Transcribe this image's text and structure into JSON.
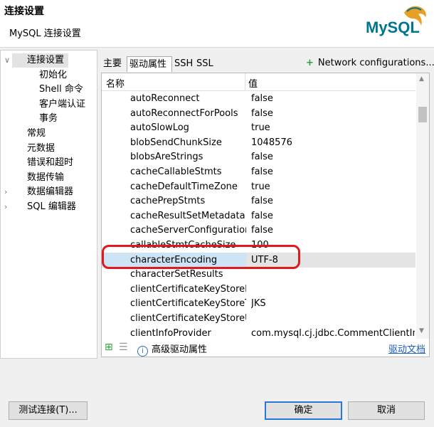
{
  "header": {
    "title": "连接设置",
    "subtitle": "MySQL 连接设置",
    "logo_text": "MySQL"
  },
  "nav": {
    "items": [
      {
        "label": "连接设置",
        "level": 0,
        "expanded": true,
        "selected": true
      },
      {
        "label": "初始化",
        "level": 1
      },
      {
        "label": "Shell 命令",
        "level": 1
      },
      {
        "label": "客户端认证",
        "level": 1
      },
      {
        "label": "事务",
        "level": 1
      },
      {
        "label": "常规",
        "level": 0
      },
      {
        "label": "元数据",
        "level": 0
      },
      {
        "label": "错误和超时",
        "level": 0
      },
      {
        "label": "数据传输",
        "level": 0
      },
      {
        "label": "数据编辑器",
        "level": 0,
        "expandable": true
      },
      {
        "label": "SQL 编辑器",
        "level": 0,
        "expandable": true
      }
    ]
  },
  "tabs": [
    {
      "label": "主要",
      "active": false
    },
    {
      "label": "驱动属性",
      "active": true
    },
    {
      "label": "SSH",
      "active": false
    },
    {
      "label": "SSL",
      "active": false
    }
  ],
  "network_config_label": "Network configurations...",
  "table": {
    "headers": {
      "name": "名称",
      "value": "值"
    },
    "rows": [
      {
        "name": "autoReconnect",
        "value": "false"
      },
      {
        "name": "autoReconnectForPools",
        "value": "false"
      },
      {
        "name": "autoSlowLog",
        "value": "true"
      },
      {
        "name": "blobSendChunkSize",
        "value": "1048576"
      },
      {
        "name": "blobsAreStrings",
        "value": "false"
      },
      {
        "name": "cacheCallableStmts",
        "value": "false"
      },
      {
        "name": "cacheDefaultTimeZone",
        "value": "true"
      },
      {
        "name": "cachePrepStmts",
        "value": "false"
      },
      {
        "name": "cacheResultSetMetadata",
        "value": "false"
      },
      {
        "name": "cacheServerConfiguration",
        "value": "false"
      },
      {
        "name": "callableStmtCacheSize",
        "value": "100"
      },
      {
        "name": "characterEncoding",
        "value": "UTF-8",
        "selected": true
      },
      {
        "name": "characterSetResults",
        "value": ""
      },
      {
        "name": "clientCertificateKeyStorePassword",
        "value": ""
      },
      {
        "name": "clientCertificateKeyStoreType",
        "value": "JKS"
      },
      {
        "name": "clientCertificateKeyStoreUrl",
        "value": ""
      },
      {
        "name": "clientInfoProvider",
        "value": "com.mysql.cj.jdbc.CommentClientInfoProvider"
      }
    ]
  },
  "bottom": {
    "advanced_label": "高级驱动属性",
    "doc_link": "驱动文档"
  },
  "footer": {
    "test_button": "测试连接(T)...",
    "ok_button": "确定",
    "cancel_button": "取消"
  },
  "colors": {
    "accent": "#2a78d6",
    "highlight": "#e0191f",
    "plus": "#2e9f3e"
  }
}
